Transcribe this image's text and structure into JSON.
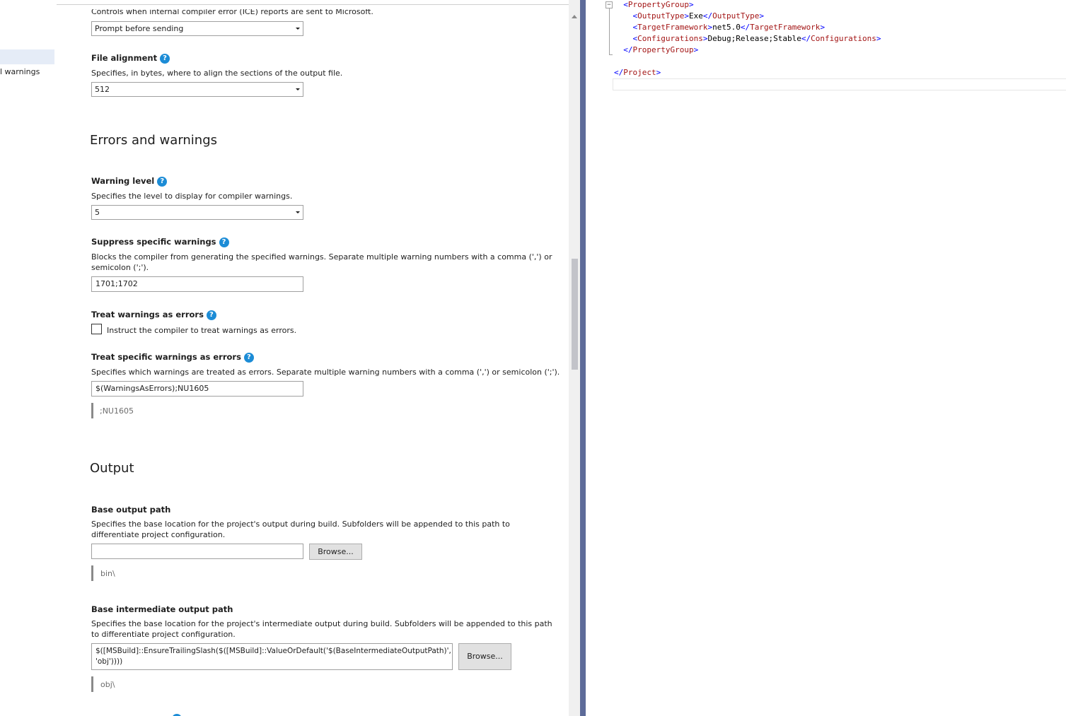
{
  "nav": {
    "selected_item": "",
    "partial_item": "l warnings"
  },
  "ice_reports": {
    "description_cut": "Controls when internal compiler error (ICE) reports are sent to Microsoft.",
    "value": "Prompt before sending"
  },
  "file_alignment": {
    "title": "File alignment",
    "description": "Specifies, in bytes, where to align the sections of the output file.",
    "value": "512"
  },
  "sections": {
    "errors_warnings": "Errors and warnings",
    "output": "Output"
  },
  "warning_level": {
    "title": "Warning level",
    "description": "Specifies the level to display for compiler warnings.",
    "value": "5"
  },
  "suppress_warnings": {
    "title": "Suppress specific warnings",
    "description_line1": "Blocks the compiler from generating the specified warnings. Separate multiple warning numbers with a comma (',') or",
    "description_line2": "semicolon (';').",
    "value": "1701;1702"
  },
  "treat_warnings_errors": {
    "title": "Treat warnings as errors",
    "checkbox_label": "Instruct the compiler to treat warnings as errors.",
    "checked": false
  },
  "treat_specific_warnings": {
    "title": "Treat specific warnings as errors",
    "description": "Specifies which warnings are treated as errors. Separate multiple warning numbers with a comma (',') or semicolon (';').",
    "value": "$(WarningsAsErrors);NU1605",
    "hint": ";NU1605"
  },
  "base_output_path": {
    "title": "Base output path",
    "description_line1": "Specifies the base location for the project's output during build. Subfolders will be appended to this path to",
    "description_line2": "differentiate project configuration.",
    "value": "",
    "browse_label": "Browse...",
    "hint": "bin\\"
  },
  "base_intermediate_path": {
    "title": "Base intermediate output path",
    "description_line1": "Specifies the base location for the project's intermediate output during build. Subfolders will be appended to this path",
    "description_line2": "to differentiate project configuration.",
    "value_line1": "$([MSBuild]::EnsureTrailingSlash($([MSBuild]::ValueOrDefault('$(BaseIntermediateOutputPath)',",
    "value_line2": "'obj'))))",
    "browse_label": "Browse...",
    "hint": "obj\\"
  },
  "help_icon_glyph": "?",
  "editor": {
    "collapse_glyph": "−",
    "lines": [
      {
        "indent": "  ",
        "open": "PropertyGroup",
        "text": "",
        "close": ""
      },
      {
        "indent": "    ",
        "open": "OutputType",
        "text": "Exe",
        "close": "OutputType"
      },
      {
        "indent": "    ",
        "open": "TargetFramework",
        "text": "net5.0",
        "close": "TargetFramework"
      },
      {
        "indent": "    ",
        "open": "Configurations",
        "text": "Debug;Release;Stable",
        "close": "Configurations"
      },
      {
        "indent": "  ",
        "open": "",
        "text": "",
        "close": "PropertyGroup"
      },
      {
        "indent": "",
        "open": "",
        "text": "",
        "close": ""
      },
      {
        "indent": "",
        "open": "",
        "text": "",
        "close": "Project"
      }
    ]
  },
  "colors": {
    "splitter": "#5d6b99",
    "help_icon": "#1c8cd6",
    "xml_tag": "#a31515",
    "xml_bracket": "#0000ff"
  }
}
